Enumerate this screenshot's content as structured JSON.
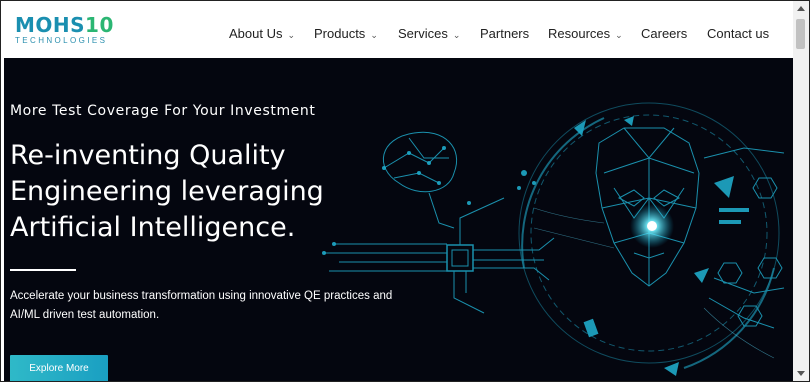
{
  "brand": {
    "logo_main_a": "MOHS",
    "logo_main_b": "10",
    "logo_sub": "TECHNOLOGIES",
    "colors": {
      "teal": "#1a8fb0",
      "green": "#2bb673",
      "hero_bg": "#04060f",
      "accent": "#2fb9c8"
    }
  },
  "nav": {
    "items": [
      {
        "label": "About Us",
        "has_dropdown": true
      },
      {
        "label": "Products",
        "has_dropdown": true
      },
      {
        "label": "Services",
        "has_dropdown": true
      },
      {
        "label": "Partners",
        "has_dropdown": false
      },
      {
        "label": "Resources",
        "has_dropdown": true
      },
      {
        "label": "Careers",
        "has_dropdown": false
      },
      {
        "label": "Contact us",
        "has_dropdown": false
      }
    ],
    "chevron_icon": "chevron-down-icon"
  },
  "hero": {
    "kicker": "More Test Coverage For Your Investment",
    "headline_lines": [
      "Re-inventing Quality",
      "Engineering leveraging",
      "Artificial Intelligence."
    ],
    "description_lines": [
      "Accelerate your business transformation using innovative QE practices and",
      "AI/ML driven test automation."
    ],
    "cta_label": "Explore More",
    "art_icon": "ai-face-circuit-illustration"
  }
}
